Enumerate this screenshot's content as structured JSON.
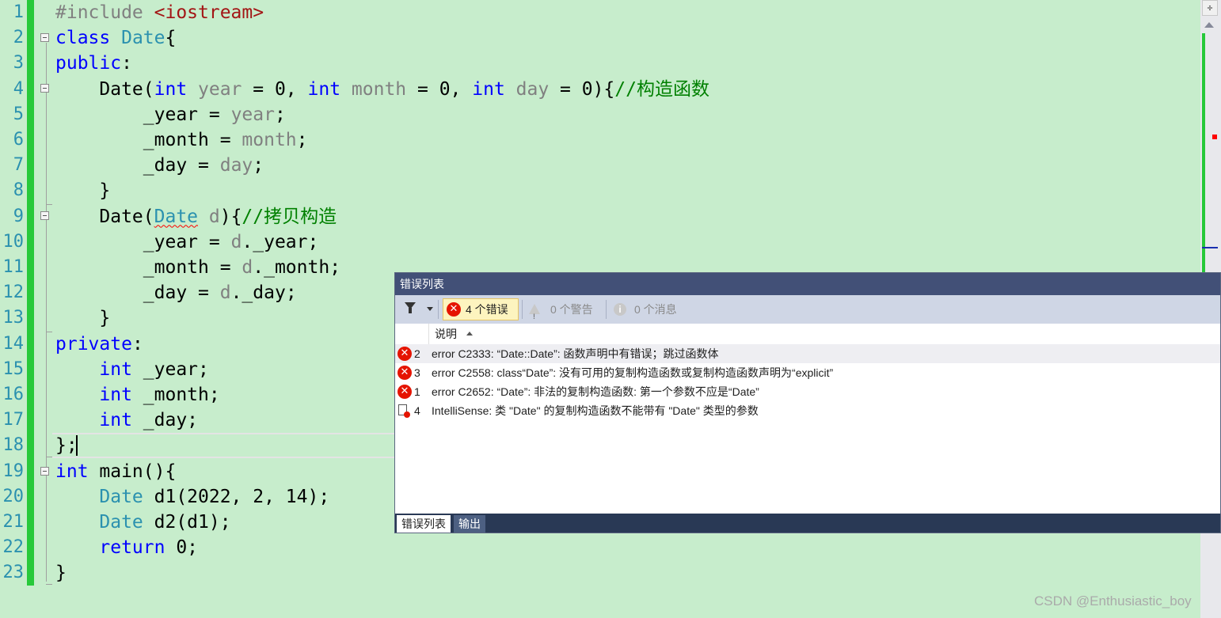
{
  "editor": {
    "line_numbers": [
      "1",
      "2",
      "3",
      "4",
      "5",
      "6",
      "7",
      "8",
      "9",
      "10",
      "11",
      "12",
      "13",
      "14",
      "15",
      "16",
      "17",
      "18",
      "19",
      "20",
      "21",
      "22",
      "23"
    ],
    "lines": [
      [
        {
          "t": "#include ",
          "c": "pp"
        },
        {
          "t": "<iostream>",
          "c": "inc"
        }
      ],
      [
        {
          "t": "class ",
          "c": "kw"
        },
        {
          "t": "Date",
          "c": "ty"
        },
        {
          "t": "{",
          "c": ""
        }
      ],
      [
        {
          "t": "public",
          "c": "kw"
        },
        {
          "t": ":",
          "c": ""
        }
      ],
      [
        {
          "t": "    Date(",
          "c": ""
        },
        {
          "t": "int",
          "c": "kw"
        },
        {
          "t": " year",
          "c": "param"
        },
        {
          "t": " = 0, ",
          "c": ""
        },
        {
          "t": "int",
          "c": "kw"
        },
        {
          "t": " month",
          "c": "param"
        },
        {
          "t": " = 0, ",
          "c": ""
        },
        {
          "t": "int",
          "c": "kw"
        },
        {
          "t": " day",
          "c": "param"
        },
        {
          "t": " = 0){",
          "c": ""
        },
        {
          "t": "//构造函数",
          "c": "cm"
        }
      ],
      [
        {
          "t": "        _year = ",
          "c": ""
        },
        {
          "t": "year",
          "c": "param"
        },
        {
          "t": ";",
          "c": ""
        }
      ],
      [
        {
          "t": "        _month = ",
          "c": ""
        },
        {
          "t": "month",
          "c": "param"
        },
        {
          "t": ";",
          "c": ""
        }
      ],
      [
        {
          "t": "        _day = ",
          "c": ""
        },
        {
          "t": "day",
          "c": "param"
        },
        {
          "t": ";",
          "c": ""
        }
      ],
      [
        {
          "t": "    }",
          "c": ""
        }
      ],
      [
        {
          "t": "    Date(",
          "c": ""
        },
        {
          "t": "Date",
          "c": "ty err"
        },
        {
          "t": " d",
          "c": "param"
        },
        {
          "t": "){",
          "c": ""
        },
        {
          "t": "//拷贝构造",
          "c": "cm"
        }
      ],
      [
        {
          "t": "        _year = ",
          "c": ""
        },
        {
          "t": "d",
          "c": "param"
        },
        {
          "t": "._year;",
          "c": ""
        }
      ],
      [
        {
          "t": "        _month = ",
          "c": ""
        },
        {
          "t": "d",
          "c": "param"
        },
        {
          "t": "._month;",
          "c": ""
        }
      ],
      [
        {
          "t": "        _day = ",
          "c": ""
        },
        {
          "t": "d",
          "c": "param"
        },
        {
          "t": "._day;",
          "c": ""
        }
      ],
      [
        {
          "t": "    }",
          "c": ""
        }
      ],
      [
        {
          "t": "private",
          "c": "kw"
        },
        {
          "t": ":",
          "c": ""
        }
      ],
      [
        {
          "t": "    ",
          "c": ""
        },
        {
          "t": "int",
          "c": "kw"
        },
        {
          "t": " _year;",
          "c": ""
        }
      ],
      [
        {
          "t": "    ",
          "c": ""
        },
        {
          "t": "int",
          "c": "kw"
        },
        {
          "t": " _month;",
          "c": ""
        }
      ],
      [
        {
          "t": "    ",
          "c": ""
        },
        {
          "t": "int",
          "c": "kw"
        },
        {
          "t": " _day;",
          "c": ""
        }
      ],
      [
        {
          "t": "};",
          "c": ""
        }
      ],
      [
        {
          "t": "int",
          "c": "kw"
        },
        {
          "t": " main(){",
          "c": ""
        }
      ],
      [
        {
          "t": "    ",
          "c": ""
        },
        {
          "t": "Date",
          "c": "ty"
        },
        {
          "t": " d1(2022, 2, 14);",
          "c": ""
        }
      ],
      [
        {
          "t": "    ",
          "c": ""
        },
        {
          "t": "Date",
          "c": "ty"
        },
        {
          "t": " d2(d1);",
          "c": ""
        }
      ],
      [
        {
          "t": "    ",
          "c": ""
        },
        {
          "t": "return",
          "c": "kw"
        },
        {
          "t": " 0;",
          "c": ""
        }
      ],
      [
        {
          "t": "}",
          "c": ""
        }
      ]
    ]
  },
  "error_list": {
    "title": "错误列表",
    "filter_errors": "4 个错误",
    "filter_warnings": "0 个警告",
    "filter_messages": "0 个消息",
    "column_description": "说明",
    "rows": [
      {
        "num": "2",
        "icon": "error-icon",
        "text": "error C2333: “Date::Date”: 函数声明中有错误；跳过函数体"
      },
      {
        "num": "3",
        "icon": "error-icon",
        "text": "error C2558: class“Date”: 没有可用的复制构造函数或复制构造函数声明为“explicit”"
      },
      {
        "num": "1",
        "icon": "error-icon",
        "text": "error C2652: “Date”: 非法的复制构造函数: 第一个参数不应是“Date”"
      },
      {
        "num": "4",
        "icon": "intellisense-error-icon",
        "text": "IntelliSense: 类 \"Date\" 的复制构造函数不能带有 \"Date\" 类型的参数"
      }
    ],
    "tab_errors": "错误列表",
    "tab_output": "输出"
  },
  "watermark": "CSDN @Enthusiastic_boy",
  "colors": {
    "background": "#c7edcc",
    "keyword": "#0000ff",
    "type": "#2b91af",
    "comment": "#008000",
    "error": "#e51400"
  }
}
